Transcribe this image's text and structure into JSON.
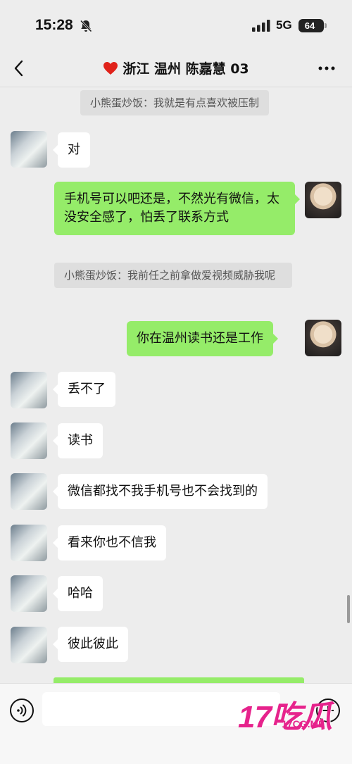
{
  "status_bar": {
    "time": "15:28",
    "network": "5G",
    "battery": "64",
    "icons": [
      "bell-slash-icon",
      "signal-icon",
      "battery-icon"
    ]
  },
  "nav": {
    "title": "浙江 温州 陈嘉慧 03",
    "icons": [
      "back-chevron-icon",
      "heart-icon",
      "more-icon"
    ]
  },
  "messages": {
    "quote_1": "小熊蛋炒饭：我就是有点喜欢被压制",
    "msg_1": "对",
    "msg_2": "手机号可以吧还是，不然光有微信，太没安全感了，怕丢了联系方式",
    "quote_2": "小熊蛋炒饭：我前任之前拿做爱视频威胁我呢",
    "msg_3": "你在温州读书还是工作",
    "msg_4": "丢不了",
    "msg_5": "读书",
    "msg_6": "微信都找不我手机号也不会找到的",
    "msg_7": "看来你也不信我",
    "msg_8": "哈哈",
    "msg_9": "彼此彼此"
  },
  "input_bar": {
    "placeholder": "",
    "icons": [
      "voice-icon",
      "plus-icon"
    ]
  },
  "watermark": {
    "main": "17吃瓜",
    "sub": "17CG.ME"
  },
  "colors": {
    "background": "#ededed",
    "bubble_self": "#95ec69",
    "bubble_other": "#ffffff",
    "watermark": "#e6238c"
  }
}
